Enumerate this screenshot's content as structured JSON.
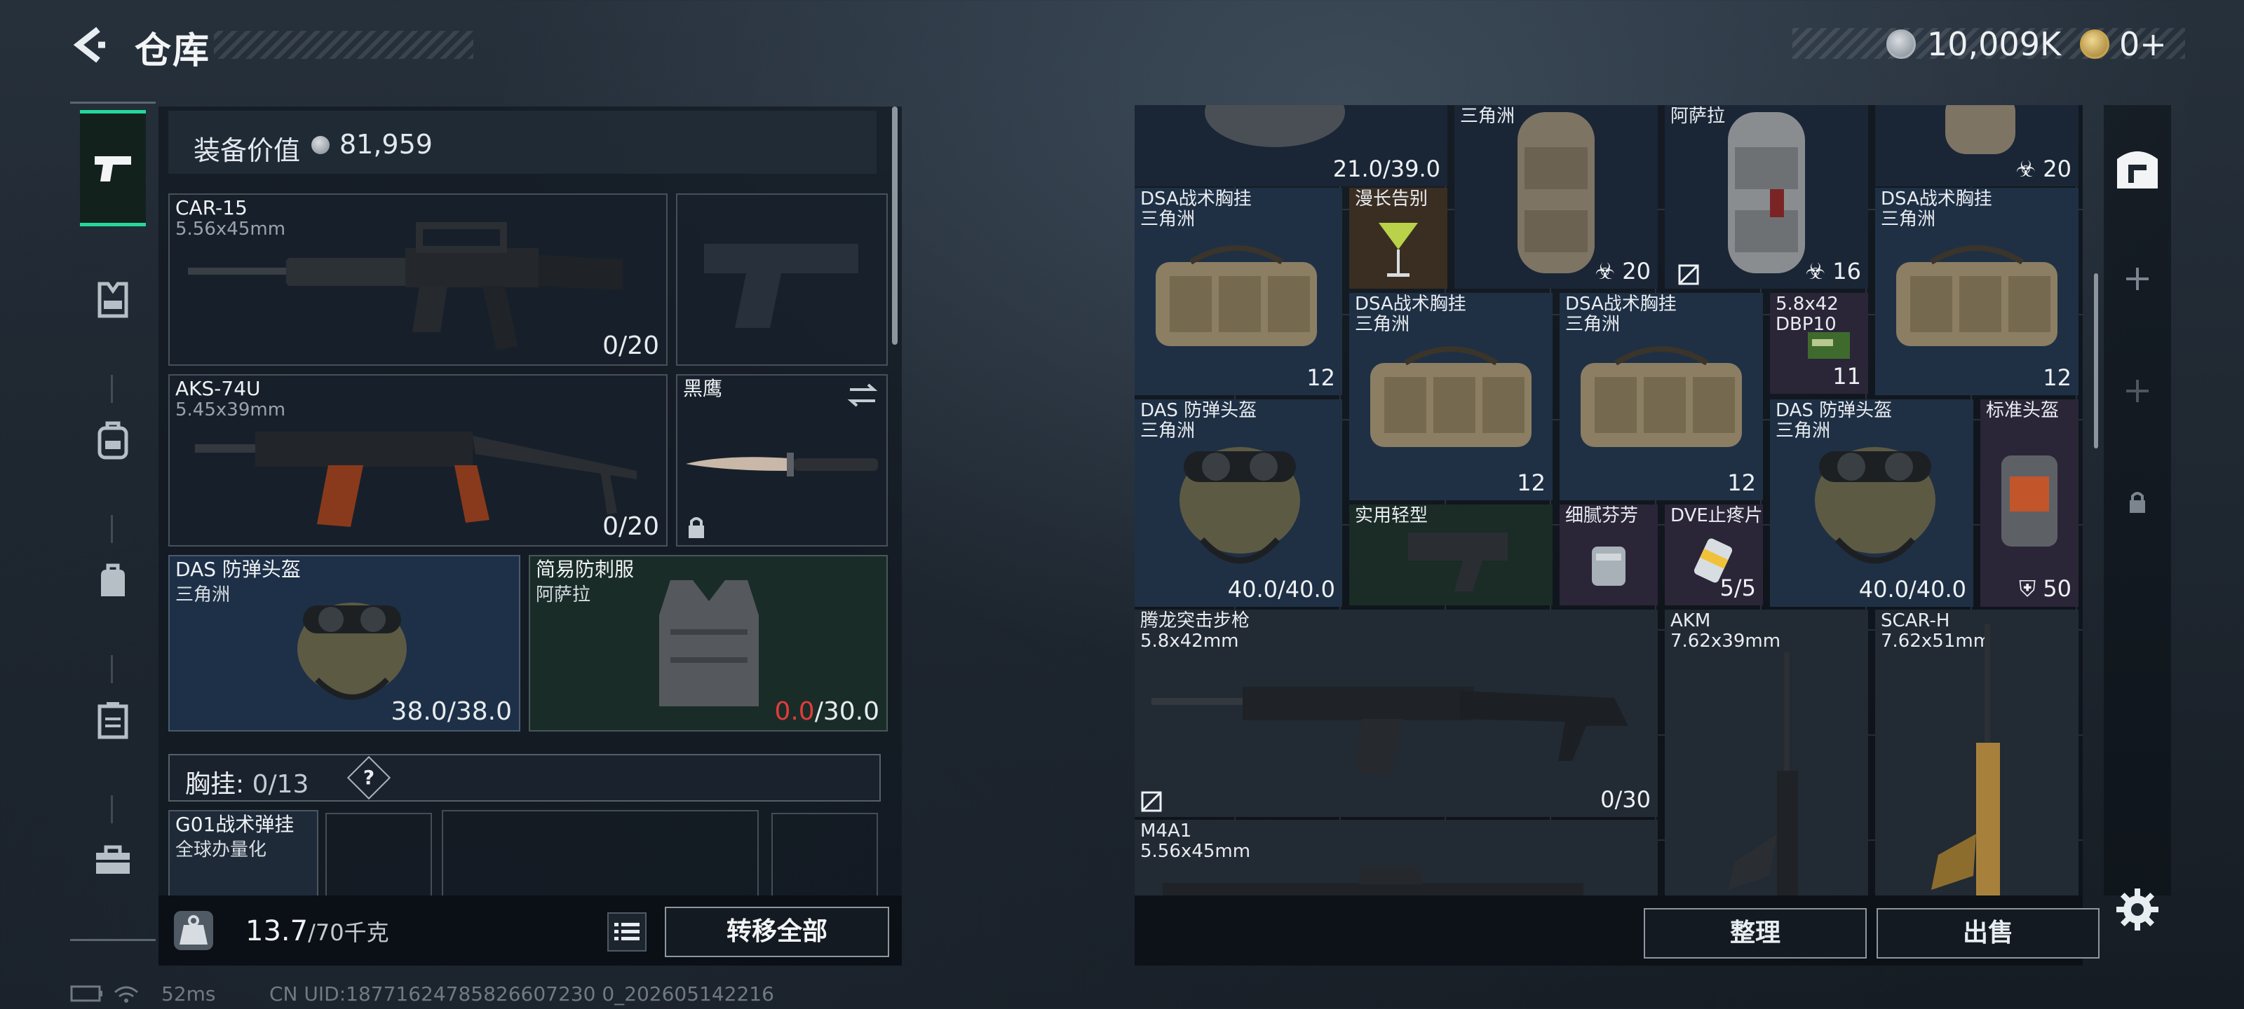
{
  "header": {
    "title": "仓库",
    "currency_1": "10,009K",
    "currency_2": "0+"
  },
  "loadout": {
    "value_label": "装备价值",
    "value": "81,959",
    "slots": {
      "primary_1": {
        "name": "CAR-15",
        "caliber": "5.56x45mm",
        "ammo": "0/20"
      },
      "primary_2": {
        "name": "AKS-74U",
        "caliber": "5.45x39mm",
        "ammo": "0/20"
      },
      "melee": {
        "name": "黑鹰"
      },
      "helmet": {
        "name": "DAS 防弹头盔",
        "origin": "三角洲",
        "durability": "38.0/38.0"
      },
      "armor": {
        "name": "简易防刺服",
        "origin": "阿萨拉",
        "durability_current": "0.0",
        "durability_max": "/30.0"
      }
    },
    "chest_rig_label": "胸挂:",
    "chest_rig_count": "0/13",
    "chest_rig_help": "?",
    "chest_item": {
      "name": "G01战术弹挂",
      "origin": "全球办量化"
    },
    "weight_current": "13.7",
    "weight_max": "/70千克",
    "transfer_all_label": "转移全部"
  },
  "stash": {
    "items": {
      "top_value": "21.0/39.0",
      "top_origin_1": "三角洲",
      "top_origin_2": "阿萨拉",
      "top_count": "20",
      "vest_a": {
        "name": "DSA战术胸挂",
        "origin": "三角洲",
        "count": "12"
      },
      "cocktail": {
        "name": "漫长告别"
      },
      "bag_a_count": "20",
      "bag_b_count": "16",
      "vest_b": {
        "name": "DSA战术胸挂",
        "origin": "三角洲",
        "count": "12"
      },
      "vest_c": {
        "name": "DSA战术胸挂",
        "origin": "三角洲",
        "count": "12"
      },
      "vest_d": {
        "name": "DSA战术胸挂",
        "origin": "三角洲",
        "count": "12"
      },
      "ammo": {
        "name": "5.8x42",
        "sub": "DBP10",
        "count": "11"
      },
      "helmet_a": {
        "name": "DAS 防弹头盔",
        "origin": "三角洲",
        "durability": "40.0/40.0"
      },
      "helmet_b": {
        "name": "DAS 防弹头盔",
        "origin": "三角洲",
        "durability": "40.0/40.0"
      },
      "standard_helmet": {
        "name": "标准头盔",
        "count": "50"
      },
      "stock": {
        "name": "实用轻型"
      },
      "fenfang": {
        "name": "细腻芬芳"
      },
      "painkiller": {
        "name": "DVE止疼片",
        "count": "5/5"
      },
      "rifle_a": {
        "name": "腾龙突击步枪",
        "caliber": "5.8x42mm",
        "ammo": "0/30"
      },
      "akm": {
        "name": "AKM",
        "caliber": "7.62x39mm"
      },
      "scar": {
        "name": "SCAR-H",
        "caliber": "7.62x51mm"
      },
      "m4a1": {
        "name": "M4A1",
        "caliber": "5.56x45mm"
      }
    },
    "sort_label": "整理",
    "sell_label": "出售"
  },
  "status_bar": {
    "ping": "52ms",
    "uid": "CN UID:18771624785826607230 0_202605142216"
  },
  "icons": {
    "back": "back-arrow-icon",
    "nav": [
      "pistol-icon",
      "vest-icon",
      "backpack-icon",
      "bag-icon",
      "case-icon",
      "toolbox-icon"
    ],
    "rail": [
      "safe-icon",
      "plus-icon",
      "plus-icon",
      "lock-icon"
    ],
    "settings": "gear-icon"
  },
  "colors": {
    "accent": "#25d79a",
    "broken": "#e23b3b",
    "blue_rarity": "#1f3045",
    "purple_rarity": "#2b2538"
  }
}
